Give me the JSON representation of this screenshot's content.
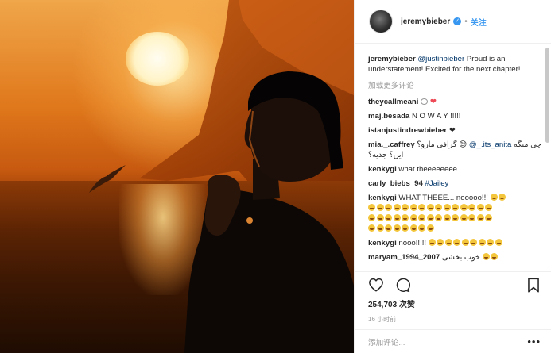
{
  "header": {
    "username": "jeremybieber",
    "verified_mark": "✓",
    "separator": "•",
    "follow_label": "关注"
  },
  "caption": {
    "username": "jeremybieber",
    "mention": "@justinbieber",
    "text": " Proud is an understatement! Excited for the next chapter!"
  },
  "load_more_label": "加载更多评论",
  "comments": [
    {
      "username": "theycallmeani",
      "text": ""
    },
    {
      "username": "maj.besada",
      "text": "N O W A Y !!!!!"
    },
    {
      "username": "istanjustindrewbieber",
      "text": "❤"
    },
    {
      "username": "mia._.caffrey",
      "text": "گرافی مارو؟ 😊",
      "mention": "@_.its_anita",
      "text2": "چی میگه این؟ جدیه؟"
    },
    {
      "username": "kenkygi",
      "text": "what theeeeeeee"
    },
    {
      "username": "carly_biebs_94",
      "text": "#Jailey"
    },
    {
      "username": "kenkygi",
      "text": "WHAT THEEE... nooooo!!!"
    },
    {
      "username": "kenkygi",
      "text": "nooo!!!!!"
    },
    {
      "username": "maryam_1994_2007",
      "text": "خوب بخشی"
    }
  ],
  "actions": {
    "like_icon": "heart-icon",
    "comment_icon": "comment-icon",
    "save_icon": "bookmark-icon",
    "likes": "254,703 次赞",
    "time": "16 小时前"
  },
  "add_comment": {
    "placeholder": "添加评论...",
    "more_label": "•••"
  },
  "colors": {
    "accent": "#3897f0",
    "text": "#262626",
    "muted": "#999999",
    "border": "#efefef"
  }
}
